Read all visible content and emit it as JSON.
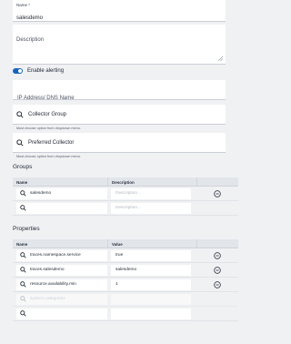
{
  "name_field": {
    "label": "Name *",
    "value": "salesdemo"
  },
  "description_field": {
    "placeholder": "Description"
  },
  "alerting": {
    "label": "Enable alerting",
    "enabled": true
  },
  "ip_field": {
    "placeholder": "IP Address/ DNS Name"
  },
  "collector_group": {
    "placeholder": "Collector Group",
    "helper": "Must choose option from dropdown menu."
  },
  "preferred_collector": {
    "placeholder": "Preferred Collector",
    "helper": "Must choose option from dropdown menu."
  },
  "groups": {
    "title": "Groups",
    "columns": {
      "name": "Name",
      "description": "Description"
    },
    "rows": [
      {
        "name": "salesdemo",
        "description_placeholder": "Description..."
      },
      {
        "name": "",
        "description_placeholder": "Description..."
      }
    ]
  },
  "properties": {
    "title": "Properties",
    "columns": {
      "name": "Name",
      "value": "Value"
    },
    "rows": [
      {
        "name": "traces.namespace.service",
        "value": "true"
      },
      {
        "name": "traces.salesdemo",
        "value": "salesdemo"
      },
      {
        "name": "resource.availability.min",
        "value": "1"
      },
      {
        "name_placeholder": "system.categories",
        "value": ""
      },
      {
        "name": "",
        "value": ""
      }
    ]
  },
  "colors": {
    "accent": "#1565c0",
    "background": "#f0f1f3"
  }
}
